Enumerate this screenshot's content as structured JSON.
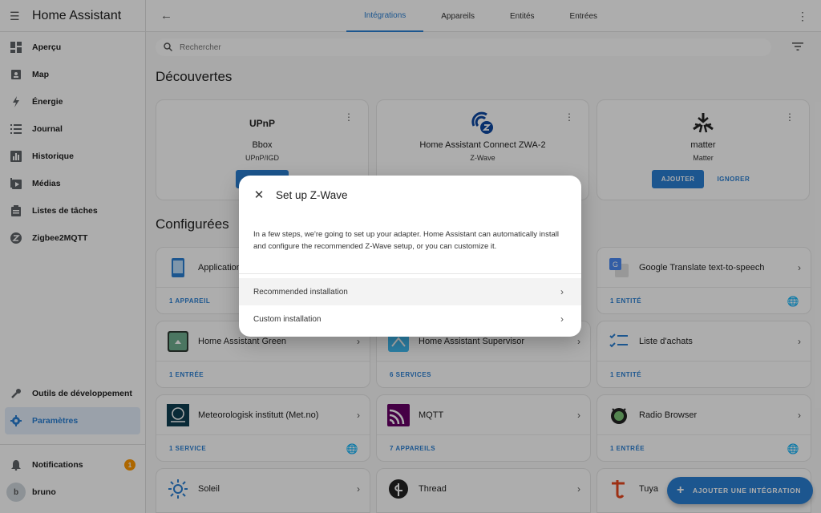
{
  "app": {
    "title": "Home Assistant"
  },
  "sidebar": {
    "items": [
      {
        "label": "Aperçu",
        "icon": "dashboard-icon"
      },
      {
        "label": "Map",
        "icon": "map-icon"
      },
      {
        "label": "Énergie",
        "icon": "lightning-icon"
      },
      {
        "label": "Journal",
        "icon": "list-icon"
      },
      {
        "label": "Historique",
        "icon": "chart-icon"
      },
      {
        "label": "Médias",
        "icon": "play-icon"
      },
      {
        "label": "Listes de tâches",
        "icon": "clipboard-icon"
      },
      {
        "label": "Zigbee2MQTT",
        "icon": "zigbee-icon"
      }
    ],
    "dev_tools": "Outils de développement",
    "settings": "Paramètres",
    "notifications": "Notifications",
    "notifications_count": "1",
    "user": "bruno",
    "user_initial": "b"
  },
  "topbar": {
    "tabs": [
      "Intégrations",
      "Appareils",
      "Entités",
      "Entrées"
    ],
    "active_tab": "Intégrations"
  },
  "search": {
    "placeholder": "Rechercher"
  },
  "discovered": {
    "title": "Découvertes",
    "cards": [
      {
        "logo": "UPnP",
        "name": "Bbox",
        "sub": "UPnP/IGD",
        "add": "AJOUTER"
      },
      {
        "logo": "zwave",
        "name": "Home Assistant Connect ZWA-2",
        "sub": "Z-Wave"
      },
      {
        "logo": "matter",
        "name": "matter",
        "sub": "Matter",
        "add": "AJOUTER",
        "ignore": "IGNORER"
      }
    ]
  },
  "configured": {
    "title": "Configurées",
    "cards": [
      {
        "name": "Application",
        "footer": "1 APPAREIL"
      },
      {
        "name": "Google Translate text-to-speech",
        "footer": "1 ENTITÉ"
      },
      {
        "name": "Home Assistant Green",
        "footer": "1 ENTRÉE"
      },
      {
        "name": "Home Assistant Supervisor",
        "footer": "6 SERVICES"
      },
      {
        "name": "Liste d'achats",
        "footer": "1 ENTITÉ"
      },
      {
        "name": "Meteorologisk institutt (Met.no)",
        "footer": "1 SERVICE"
      },
      {
        "name": "MQTT",
        "footer": "7 APPAREILS"
      },
      {
        "name": "Radio Browser",
        "footer": "1 ENTRÉE"
      },
      {
        "name": "Soleil",
        "footer": ""
      },
      {
        "name": "Thread",
        "footer": ""
      },
      {
        "name": "Tuya",
        "footer": ""
      }
    ]
  },
  "dialog": {
    "title": "Set up Z-Wave",
    "text": "In a few steps, we're going to set up your adapter. Home Assistant can automatically install and configure the recommended Z-Wave setup, or you can customize it.",
    "option_recommended": "Recommended installation",
    "option_custom": "Custom installation"
  },
  "fab": {
    "label": "AJOUTER UNE INTÉGRATION"
  },
  "colors": {
    "accent": "#2a7fd3",
    "badge": "#ff9800",
    "overlay": "rgba(0,0,0,0.32)"
  }
}
